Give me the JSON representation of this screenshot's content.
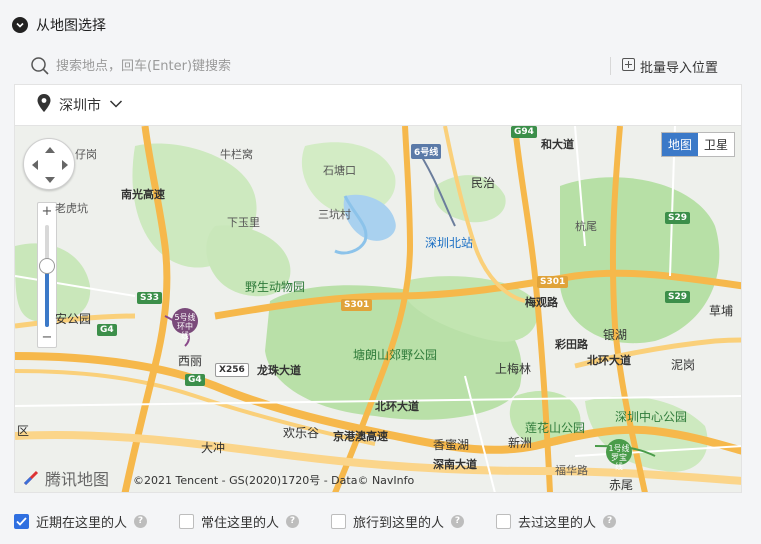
{
  "header": {
    "title": "从地图选择"
  },
  "search": {
    "placeholder": "搜索地点，回车(Enter)键搜索",
    "value": "",
    "import_label": "批量导入位置"
  },
  "city": {
    "label": "深圳市"
  },
  "map": {
    "type_buttons": [
      {
        "label": "地图",
        "active": true
      },
      {
        "label": "卫星",
        "active": false
      }
    ],
    "zoom_level": 0.6,
    "copyright": "©2021 Tencent - GS(2020)1720号 - Data© NavInfo",
    "logo_text": "腾讯地图",
    "labels": {
      "niuchiwo": "牛栏窝",
      "shitanglong": "石塘口",
      "xiawuli": "下玉里",
      "sankacun": "三坑村",
      "minzhi": "民治",
      "shenzhenbeizhan": "深圳北站",
      "yeshengdongwuyuan": "野生动物园",
      "tanglangshan": "塘朗山郊野公园",
      "shangmeilin": "上梅林",
      "xili": "西丽",
      "huanlegu": "欢乐谷",
      "dachong": "大冲",
      "xiangmihu": "香蜜湖",
      "xinzhou": "新洲",
      "lianhuashan": "莲花山公园",
      "shenzhenzhongxin": "深圳中心公园",
      "yinhu": "银湖",
      "nigang": "泥岗",
      "caopu": "草埔",
      "anGongyuan": "安公园",
      "laihuhu": "老虎坑",
      "xiaozai": "仔岗",
      "ganghang": "杭尾",
      "futian": "福华路",
      "chiwei": "赤尾",
      "kewan": "区",
      "xinan": "彩田路",
      "meilinguan": "梅观路",
      "longzhu": "龙珠大道",
      "beihuan": "北环大道",
      "jingyue": "京港澳高速",
      "shennan": "深南大道",
      "nanguang": "南光高速",
      "minzhidadao": "和大道",
      "beihuan2": "北环大道"
    },
    "badges": [
      "S301",
      "S301",
      "S33",
      "G4",
      "G4",
      "S29",
      "S29",
      "G94",
      "6号线",
      "X256"
    ],
    "metro": [
      "5号线 环中线",
      "1号线 罗宝线"
    ]
  },
  "options": [
    {
      "label": "近期在这里的人",
      "checked": true
    },
    {
      "label": "常住这里的人",
      "checked": false
    },
    {
      "label": "旅行到这里的人",
      "checked": false
    },
    {
      "label": "去过这里的人",
      "checked": false
    }
  ]
}
